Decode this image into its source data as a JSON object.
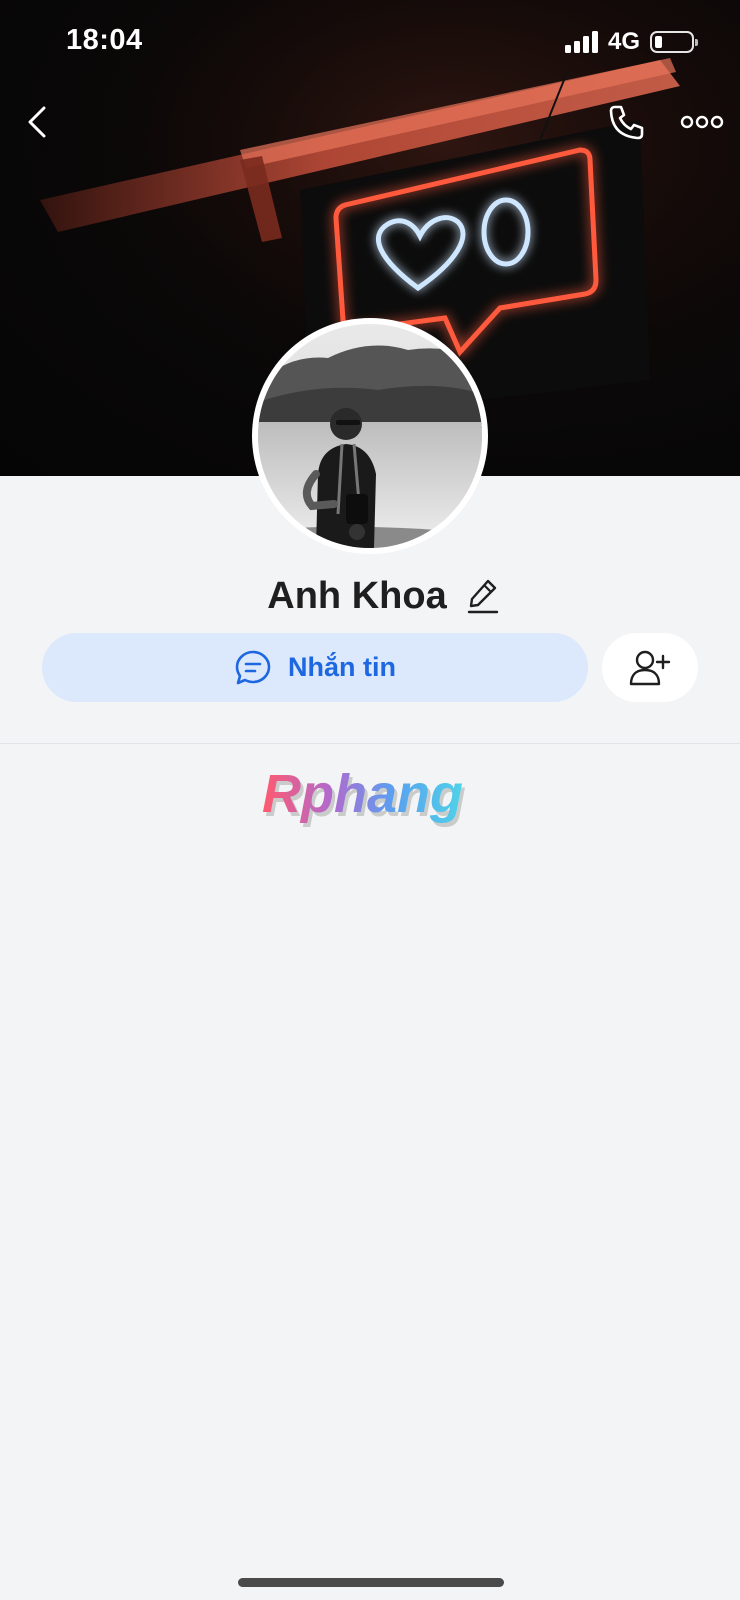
{
  "status_bar": {
    "time": "18:04",
    "network": "4G",
    "battery_level_percent": 20
  },
  "nav": {
    "back_icon": "chevron-left-icon",
    "call_icon": "phone-icon",
    "more_icon": "more-horizontal-icon"
  },
  "cover": {
    "description_icon": "neon-like-sign-image"
  },
  "profile": {
    "name": "Anh Khoa",
    "edit_icon": "pencil-icon"
  },
  "actions": {
    "message_label": "Nhắn tin",
    "message_icon": "chat-bubble-icon",
    "add_friend_icon": "add-user-icon"
  },
  "watermark": {
    "logo_text": "Rphang"
  },
  "colors": {
    "accent": "#1d68e0",
    "message_bg": "#dce8fc",
    "background": "#f3f4f6",
    "name": "#1f1f1f"
  }
}
